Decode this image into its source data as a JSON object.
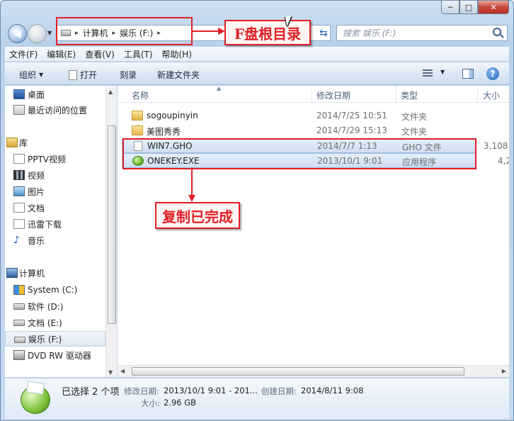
{
  "window": {
    "caption_buttons": {
      "minimize": "─",
      "maximize": "□",
      "close": "✕"
    }
  },
  "address": {
    "segments": [
      "计算机",
      "娱乐 (F:)"
    ],
    "separator": "▸",
    "search_placeholder": "搜索 娱乐 (F:)"
  },
  "menu": [
    "文件(F)",
    "编辑(E)",
    "查看(V)",
    "工具(T)",
    "帮助(H)"
  ],
  "toolbar": {
    "organize": "组织",
    "open": "打开",
    "burn": "刻录",
    "new_folder": "新建文件夹",
    "help": "?"
  },
  "nav": {
    "favorites": [
      "桌面",
      "最近访问的位置"
    ],
    "library_title": "库",
    "libraries": [
      "PPTV视频",
      "视频",
      "图片",
      "文档",
      "迅雷下载",
      "音乐"
    ],
    "computer_title": "计算机",
    "drives": [
      "System (C:)",
      "软件 (D:)",
      "文档 (E:)",
      "娱乐 (F:)",
      "DVD RW 驱动器"
    ],
    "selected": "娱乐 (F:)"
  },
  "columns": {
    "name": "名称",
    "date": "修改日期",
    "type": "类型",
    "size": "大小"
  },
  "files": [
    {
      "name": "sogoupinyin",
      "date": "2014/7/25 10:51",
      "type": "文件夹",
      "size": "",
      "icon": "folder-icon"
    },
    {
      "name": "美图秀秀",
      "date": "2014/7/29 15:13",
      "type": "文件夹",
      "size": "",
      "icon": "folder-icon"
    },
    {
      "name": "WIN7.GHO",
      "date": "2014/7/7 1:13",
      "type": "GHO 文件",
      "size": "3,108",
      "icon": "file-icon",
      "selected": true
    },
    {
      "name": "ONEKEY.EXE",
      "date": "2013/10/1 9:01",
      "type": "应用程序",
      "size": "4,2",
      "icon": "exe-icon",
      "selected": true
    }
  ],
  "details": {
    "count": "已选择 2 个项",
    "modified_label": "修改日期:",
    "modified_value": "2013/10/1 9:01 - 201...",
    "created_label": "创建日期:",
    "created_value": "2014/8/11 9:08",
    "size_label": "大小:",
    "size_value": "2.96 GB"
  },
  "annotations": {
    "root_label": "F盘根目录",
    "done_label": "复制已完成",
    "color": "#e01f26"
  }
}
